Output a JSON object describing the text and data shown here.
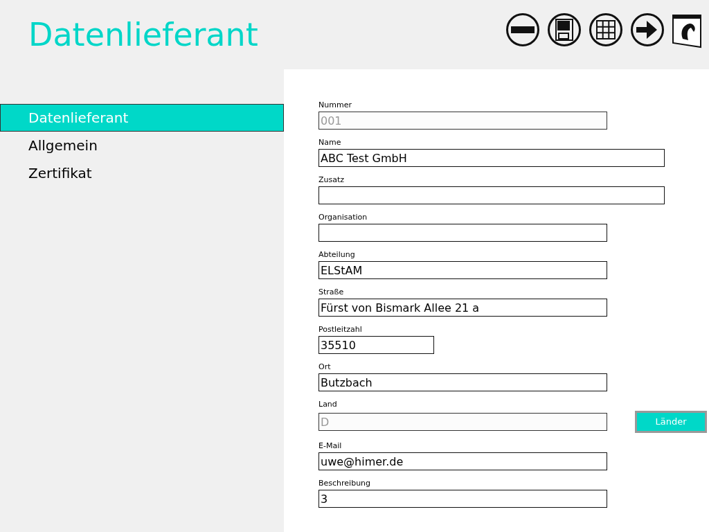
{
  "title": "Datenlieferant",
  "toolbar": [
    {
      "kind": "minus"
    },
    {
      "kind": "save"
    },
    {
      "kind": "grid"
    },
    {
      "kind": "next"
    },
    {
      "kind": "window"
    }
  ],
  "nav": [
    {
      "label": "Datenlieferant",
      "selected": true
    },
    {
      "label": "Allgemein",
      "selected": false
    },
    {
      "label": "Zertifikat",
      "selected": false
    }
  ],
  "fields": [
    {
      "label": "Nummer",
      "value": "001",
      "kind": "medium",
      "disabled": true
    },
    {
      "label": "Name",
      "value": "ABC Test GmbH",
      "kind": "wide",
      "disabled": false
    },
    {
      "label": "Zusatz",
      "kind": "wide",
      "disabled": false
    },
    {
      "label": "Organisation",
      "kind": "medium",
      "disabled": false
    },
    {
      "label": "Abteilung",
      "value": "ELStAM",
      "kind": "medium",
      "disabled": false
    },
    {
      "label": "Straße",
      "value": "Fürst von Bismark Allee 21 a",
      "kind": "medium",
      "disabled": false
    },
    {
      "label": "Postleitzahl",
      "value": "35510",
      "kind": "short",
      "disabled": false
    },
    {
      "label": "Ort",
      "value": "Butzbach",
      "kind": "medium",
      "disabled": false
    },
    {
      "label": "Land",
      "value": "D",
      "kind": "medium",
      "disabled": true,
      "button": "Länder"
    },
    {
      "label": "E-Mail",
      "value": "uwe@himer.de",
      "kind": "medium",
      "disabled": false
    },
    {
      "label": "Beschreibung",
      "value": "3",
      "kind": "medium",
      "disabled": false
    }
  ]
}
